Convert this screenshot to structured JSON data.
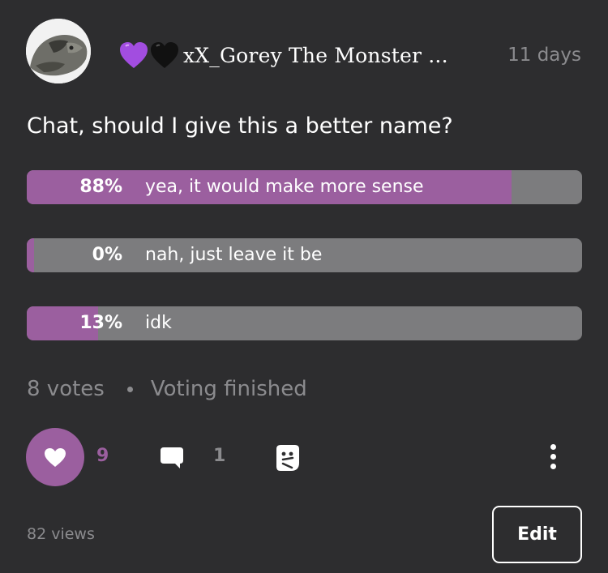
{
  "post": {
    "author": {
      "name": "xX_Gorey The Monster ...",
      "badges": [
        "purple-heart-icon",
        "black-heart-icon"
      ]
    },
    "timestamp": "11 days",
    "question": "Chat, should I give this a better name?"
  },
  "poll": {
    "options": [
      {
        "percent_label": "88%",
        "text": "yea, it would make more sense",
        "percent": 88
      },
      {
        "percent_label": "0%",
        "text": "nah, just leave it be",
        "percent": 0
      },
      {
        "percent_label": "13%",
        "text": "idk",
        "percent": 13
      }
    ],
    "votes": "8 votes",
    "status": "Voting finished"
  },
  "actions": {
    "like_count": "9",
    "comment_count": "1"
  },
  "footer": {
    "views": "82 views",
    "edit_label": "Edit"
  },
  "colors": {
    "background": "#2d2d2f",
    "accent": "#9b5f9f",
    "bar_track": "#7c7c7e",
    "muted_text": "#8b8b8e"
  }
}
